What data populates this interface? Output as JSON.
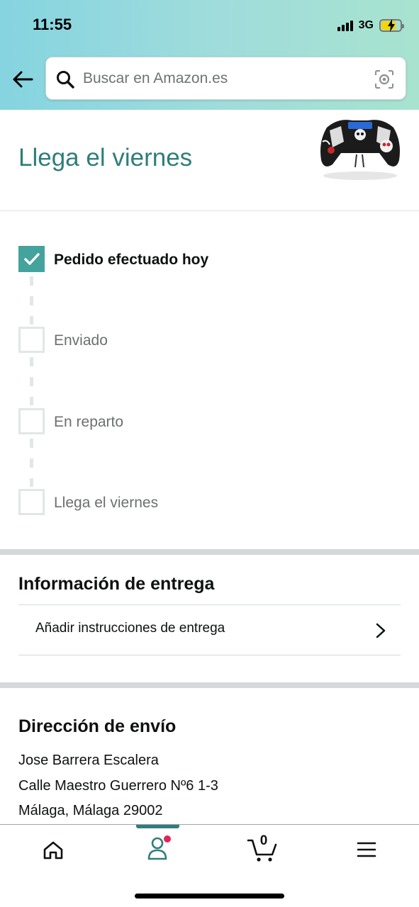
{
  "status_bar": {
    "time": "11:55",
    "network": "3G"
  },
  "search": {
    "placeholder": "Buscar en Amazon.es"
  },
  "arrival": {
    "title": "Llega el viernes"
  },
  "tracker": {
    "steps": [
      {
        "label": "Pedido efectuado hoy",
        "done": true
      },
      {
        "label": "Enviado",
        "done": false
      },
      {
        "label": "En reparto",
        "done": false
      },
      {
        "label": "Llega el viernes",
        "done": false
      }
    ]
  },
  "delivery_info": {
    "title": "Información de entrega",
    "add_instructions": "Añadir instrucciones de entrega"
  },
  "shipping_address": {
    "title": "Dirección de envío",
    "name": "Jose Barrera Escalera",
    "street": "Calle Maestro Guerrero Nº6 1-3",
    "city": "Málaga, Málaga 29002"
  },
  "bottom_nav": {
    "items": [
      {
        "icon": "home-icon"
      },
      {
        "icon": "account-icon",
        "active": true
      },
      {
        "icon": "cart-icon"
      },
      {
        "icon": "menu-icon"
      }
    ],
    "cart_count": "0",
    "accent_color": "#2f7e7a",
    "notification_color": "#e0245e"
  },
  "colors": {
    "header_start": "#85d4e0",
    "header_end": "#a8e3cf",
    "step_done": "#44a39c",
    "title_teal": "#2f7e7a"
  }
}
